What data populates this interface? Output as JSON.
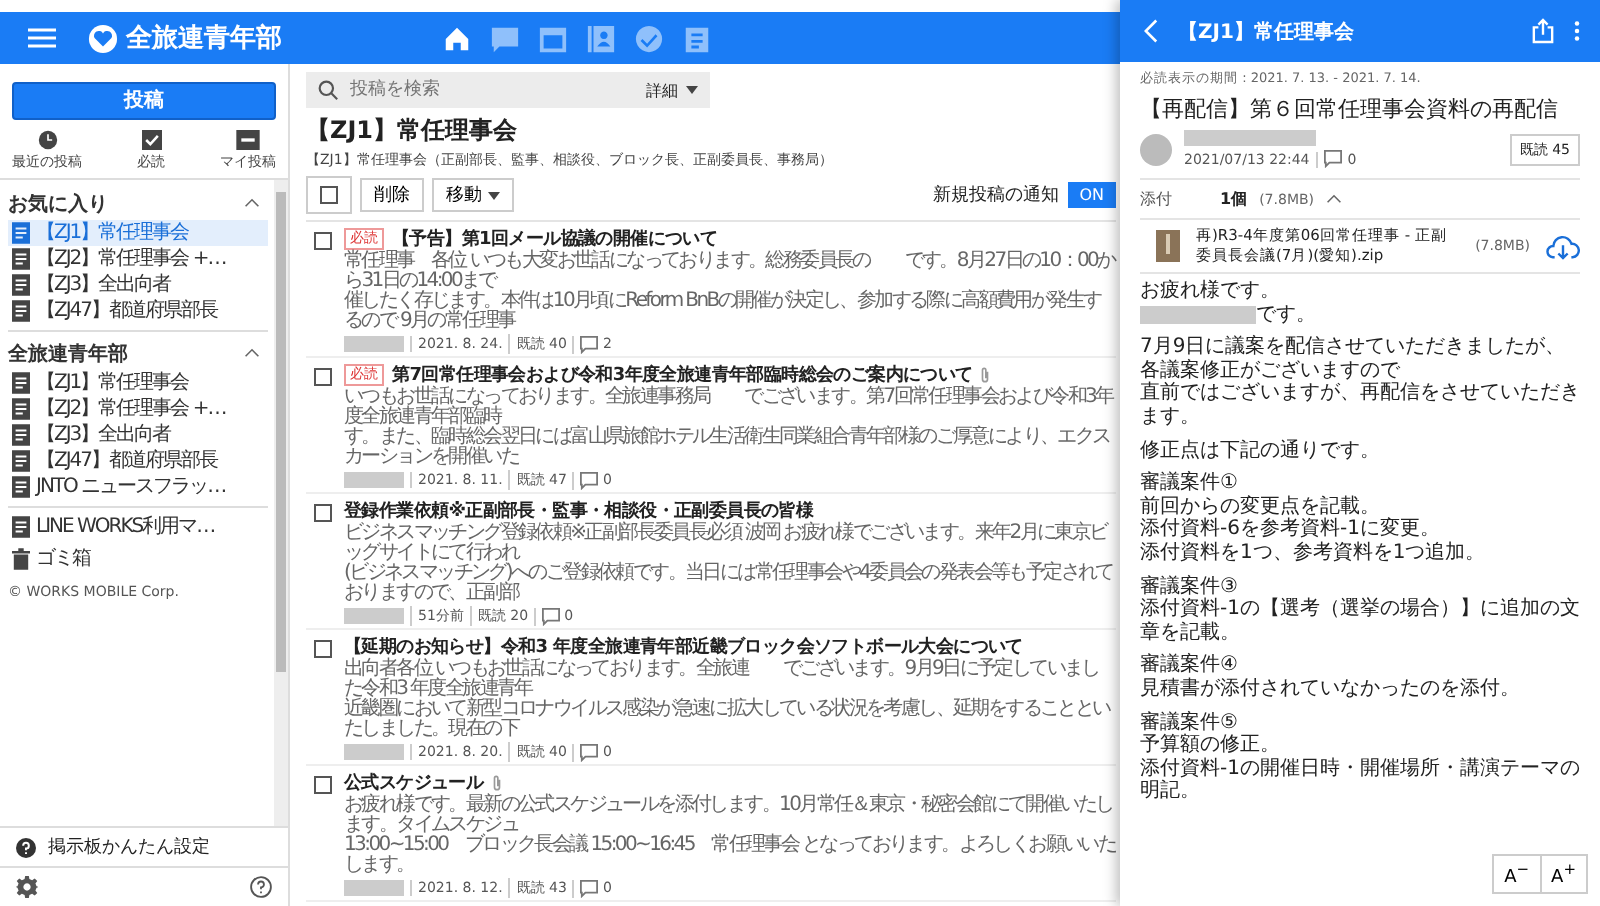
{
  "app": {
    "title": "全旅連青年部"
  },
  "nav_icons": [
    {
      "selected": true
    },
    {
      "selected": false
    },
    {
      "selected": false
    },
    {
      "selected": false
    },
    {
      "selected": false
    },
    {
      "selected": false
    }
  ],
  "sidebar": {
    "post_button": "投稿",
    "shortcuts": [
      "最近の投稿",
      "必読",
      "マイ投稿"
    ],
    "sections": [
      {
        "title": "お気に入り",
        "expanded": true,
        "items": [
          {
            "label": "【ZJ1】常任理事会",
            "selected": true
          },
          {
            "label": "【ZJ2】常任理事会 +…",
            "selected": false
          },
          {
            "label": "【ZJ3】全出向者",
            "selected": false
          },
          {
            "label": "【ZJ47】都道府県部長",
            "selected": false
          }
        ]
      },
      {
        "title": "全旅連青年部",
        "expanded": true,
        "items": [
          {
            "label": "【ZJ1】常任理事会",
            "selected": false
          },
          {
            "label": "【ZJ2】常任理事会 +…",
            "selected": false
          },
          {
            "label": "【ZJ3】全出向者",
            "selected": false
          },
          {
            "label": "【ZJ47】都道府県部長",
            "selected": false
          },
          {
            "label": "JNTO ニュースフラッ…",
            "selected": false
          }
        ]
      }
    ],
    "extra_items": [
      "LINE WORKS利用マ…",
      "ゴミ箱"
    ],
    "copyright": "© WORKS MOBILE Corp.",
    "setup_link": "掲示板かんたん設定"
  },
  "board": {
    "search": {
      "placeholder": "投稿を検索",
      "detail": "詳細"
    },
    "title": "【ZJ1】常任理事会",
    "description": "【ZJ1】常任理事会（正副部長、監事、相談役、ブロック長、正副委員長、事務局）",
    "select_all_checked": false,
    "delete_button": "削除",
    "move_button": "移動",
    "notify_label": "新規投稿の通知",
    "notify": {
      "on": true,
      "label": "ON"
    },
    "posts": [
      {
        "checked": false,
        "tag": "必読",
        "title": "【予告】第1回メール協議の開催について",
        "attachment": false,
        "excerpt_lines": [
          "常任理事　各位 いつも大変お世話になっております。総務委員長の　　です。8月27日の10：00から31日の14:00まで",
          "催したく存じます。本件は10月頃にReform BnBの開催が決定し、参加する際に高額費用が発生するので 9月の常任理事"
        ],
        "date": "2021. 8. 24.",
        "reads": "既読 40",
        "comments": "2"
      },
      {
        "checked": false,
        "tag": "必読",
        "title": "第7回常任理事会および令和3年度全旅連青年部臨時総会のご案内について",
        "attachment": true,
        "excerpt_lines": [
          "いつもお世話になっております。全旅連事務局　　でございます。第7回常任理事会および令和3年度全旅連青年部臨時",
          "す。また、臨時総会翌日には富山県旅館ホテル生活衛生同業組合青年部様のご厚意により、エクスカーションを開催いた"
        ],
        "date": "2021. 8. 11.",
        "reads": "既読 47",
        "comments": "0"
      },
      {
        "checked": false,
        "title": "登録作業依頼※正副部長・監事・相談役・正副委員長の皆様",
        "attachment": false,
        "excerpt_lines": [
          "ビジネスマッチング登録依頼※正副部長委員長必須 波岡 お疲れ様でございます。来年2月に東京ビッグサイトにて行われ",
          "(ビジネスマッチング)へのご登録依頼です。当日には常任理事会や4委員会の発表会等も予定されておりますので、正副部"
        ],
        "date": "51分前",
        "reads": "既読 20",
        "comments": "0"
      },
      {
        "checked": false,
        "title": "【延期のお知らせ】令和3 年度全旅連青年部近畿ブロック会ソフトボール大会について",
        "attachment": false,
        "excerpt_lines": [
          "出向者各位 いつもお世話になっております。全旅連　　でございます。9月9日に予定していました令和3 年度全旅連青年",
          "近畿圏において新型コロナウイルス感染が急速に拡大している状況を考慮し、延期をすることといたしました。現在の下"
        ],
        "date": "2021. 8. 20.",
        "reads": "既読 40",
        "comments": "0"
      },
      {
        "checked": false,
        "title": "公式スケジュール",
        "attachment": true,
        "excerpt_lines": [
          "お疲れ様です。最新の公式スケジュールを添付します。10月常任＆東京・秘密会館にて開催いたします。タイムスケジュ",
          "13:00~15:00　ブロック長会議 15:00~16:45　常任理事会 となっております。よろしくお願いいたします。"
        ],
        "date": "2021. 8. 12.",
        "reads": "既読 43",
        "comments": "0"
      }
    ]
  },
  "panel": {
    "title": "【ZJ1】常任理事会",
    "read_period": "必読表示の期間 : 2021. 7. 13. - 2021. 7. 14.",
    "post_title": "【再配信】第６回常任理事会資料の再配信",
    "date": "2021/07/13 22:44",
    "comments": "0",
    "reads": "既読 45",
    "attachment": {
      "label": "添付",
      "count": "1個",
      "size": "(7.8MB)",
      "expanded": true,
      "file_name": "再)R3-4年度第06回常任理事 - 正副委員長会議(7月)(愛知).zip",
      "file_size": "(7.8MB)"
    },
    "body": [
      [
        {
          "text": "お疲れ様です。",
          "redacted": false
        },
        {
          "text": "です。",
          "redacted": true
        }
      ],
      [
        {
          "text": "7月9日に議案を配信させていただきましたが、各議案修正がございますので",
          "redacted": false
        },
        {
          "text": "直前ではございますが、再配信をさせていただきます。",
          "redacted": false
        }
      ],
      [
        {
          "text": "修正点は下記の通りです。",
          "redacted": false
        }
      ],
      [
        {
          "text": "審議案件①",
          "redacted": false
        },
        {
          "text": "前回からの変更点を記載。",
          "redacted": false
        },
        {
          "text": "添付資料-6を参考資料-1に変更。",
          "redacted": false
        },
        {
          "text": "添付資料を1つ、参考資料を1つ追加。",
          "redacted": false
        }
      ],
      [
        {
          "text": "審議案件③",
          "redacted": false
        },
        {
          "text": "添付資料-1の【選考（選挙の場合）】に追加の文章を記載。",
          "redacted": false
        }
      ],
      [
        {
          "text": "審議案件④",
          "redacted": false
        },
        {
          "text": "見積書が添付されていなかったのを添付。",
          "redacted": false
        }
      ],
      [
        {
          "text": "審議案件⑤",
          "redacted": false
        },
        {
          "text": "予算額の修正。",
          "redacted": false
        },
        {
          "text": "添付資料-1の開催日時・開催場所・講演テーマの明記。",
          "redacted": false
        }
      ]
    ],
    "font_buttons": [
      "A$^{−}$",
      "A$^{+}$"
    ]
  }
}
